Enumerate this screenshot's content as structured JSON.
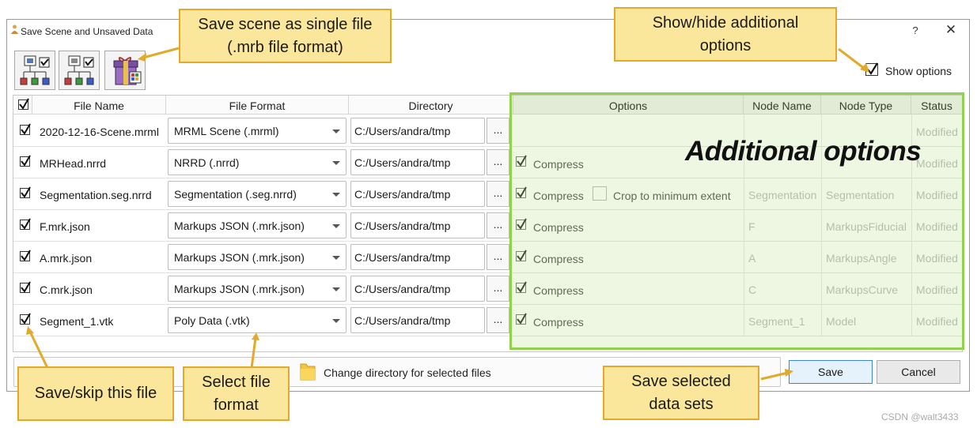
{
  "window": {
    "title": "Save Scene and Unsaved Data",
    "help": "?",
    "close": "✕"
  },
  "toolbar": {
    "buttons": [
      "save-scene-button",
      "save-data-button",
      "save-bundle-button"
    ]
  },
  "show_options": {
    "label": "Show options",
    "checked": true
  },
  "table": {
    "headers": {
      "select_all": "",
      "file_name": "File Name",
      "file_format": "File Format",
      "directory": "Directory",
      "options": "Options",
      "node_name": "Node Name",
      "node_type": "Node Type",
      "status": "Status"
    },
    "rows": [
      {
        "file_name": "2020-12-16-Scene.mrml",
        "format": "MRML Scene (.mrml)",
        "directory": "C:/Users/andra/tmp",
        "dots": "...",
        "compress": "",
        "crop": "",
        "node_name": "",
        "node_type": "",
        "status": "Modified"
      },
      {
        "file_name": "MRHead.nrrd",
        "format": "NRRD (.nrrd)",
        "directory": "C:/Users/andra/tmp",
        "dots": "...",
        "compress": "Compress",
        "crop": "",
        "node_name": "",
        "node_type": "",
        "status": "Modified"
      },
      {
        "file_name": "Segmentation.seg.nrrd",
        "format": "Segmentation (.seg.nrrd)",
        "directory": "C:/Users/andra/tmp",
        "dots": "...",
        "compress": "Compress",
        "crop": "Crop to minimum extent",
        "node_name": "Segmentation",
        "node_type": "Segmentation",
        "status": "Modified"
      },
      {
        "file_name": "F.mrk.json",
        "format": "Markups JSON (.mrk.json)",
        "directory": "C:/Users/andra/tmp",
        "dots": "...",
        "compress": "Compress",
        "crop": "",
        "node_name": "F",
        "node_type": "MarkupsFiducial",
        "status": "Modified"
      },
      {
        "file_name": "A.mrk.json",
        "format": "Markups JSON (.mrk.json)",
        "directory": "C:/Users/andra/tmp",
        "dots": "...",
        "compress": "Compress",
        "crop": "",
        "node_name": "A",
        "node_type": "MarkupsAngle",
        "status": "Modified"
      },
      {
        "file_name": "C.mrk.json",
        "format": "Markups JSON (.mrk.json)",
        "directory": "C:/Users/andra/tmp",
        "dots": "...",
        "compress": "Compress",
        "crop": "",
        "node_name": "C",
        "node_type": "MarkupsCurve",
        "status": "Modified"
      },
      {
        "file_name": "Segment_1.vtk",
        "format": "Poly Data (.vtk)",
        "directory": "C:/Users/andra/tmp",
        "dots": "...",
        "compress": "Compress",
        "crop": "",
        "node_name": "Segment_1",
        "node_type": "Model",
        "status": "Modified"
      }
    ]
  },
  "bottom": {
    "change_directory": "Change directory for selected files",
    "save": "Save",
    "cancel": "Cancel"
  },
  "overlay": {
    "additional_options": "Additional options"
  },
  "callouts": {
    "save_scene_line1": "Save scene as single file",
    "save_scene_line2": "(.mrb file format)",
    "show_hide_line1": "Show/hide additional",
    "show_hide_line2": "options",
    "save_skip": "Save/skip this file",
    "select_format_line1": "Select file",
    "select_format_line2": "format",
    "save_selected_line1": "Save selected",
    "save_selected_line2": "data sets"
  },
  "watermark": "CSDN @walt3433",
  "colors": {
    "overlay_green": "#92d050",
    "callout_fill": "#fbe79c",
    "callout_border": "#e2a92a",
    "save_button_border": "#3c84d6"
  }
}
